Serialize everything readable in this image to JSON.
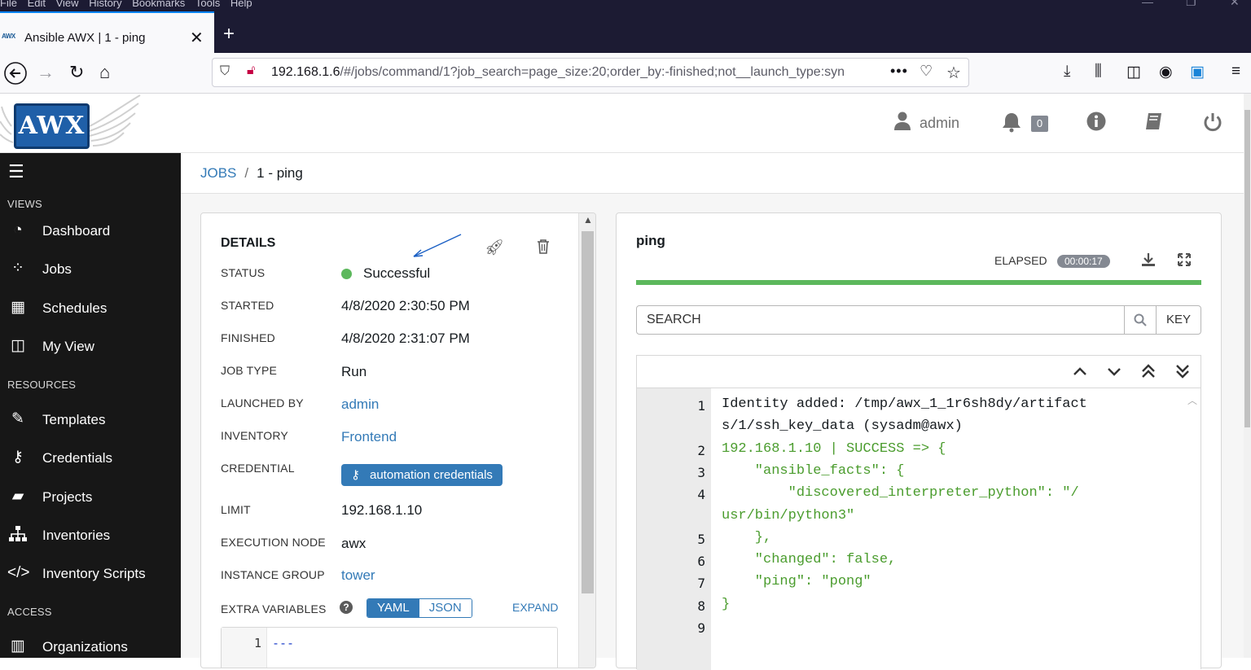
{
  "browser": {
    "menu": [
      "File",
      "Edit",
      "View",
      "History",
      "Bookmarks",
      "Tools",
      "Help"
    ],
    "tab_title": "Ansible AWX | 1 - ping",
    "tab_favicon_text": "AWX",
    "url_host": "192.168.1.6",
    "url_path": "/#/jobs/command/1?job_search=page_size:20;order_by:-finished;not__launch_type:syn",
    "icons": [
      "back-icon",
      "forward-icon",
      "reload-icon",
      "home-icon",
      "shield-icon",
      "insecure-lock-icon",
      "page-actions-icon",
      "pocket-icon",
      "bookmark-star-icon",
      "download-icon",
      "library-icon",
      "sidebar-icon",
      "account-icon",
      "extension-icon",
      "menu-icon"
    ]
  },
  "header": {
    "logo_text": "AWX",
    "user": "admin",
    "notifications_count": "0"
  },
  "sidebar": {
    "sections": {
      "views": "VIEWS",
      "resources": "RESOURCES",
      "access": "ACCESS"
    },
    "items": [
      {
        "label": "Dashboard",
        "icon": "tachometer-icon"
      },
      {
        "label": "Jobs",
        "icon": "spinner-icon"
      },
      {
        "label": "Schedules",
        "icon": "calendar-icon"
      },
      {
        "label": "My View",
        "icon": "columns-icon"
      },
      {
        "label": "Templates",
        "icon": "edit-icon"
      },
      {
        "label": "Credentials",
        "icon": "key-icon"
      },
      {
        "label": "Projects",
        "icon": "folder-icon"
      },
      {
        "label": "Inventories",
        "icon": "sitemap-icon"
      },
      {
        "label": "Inventory Scripts",
        "icon": "code-icon"
      },
      {
        "label": "Organizations",
        "icon": "building-icon"
      }
    ]
  },
  "breadcrumb": {
    "parent": "JOBS",
    "separator": "/",
    "current": "1 - ping"
  },
  "details": {
    "title": "DETAILS",
    "rows": {
      "status": {
        "label": "STATUS",
        "value": "Successful"
      },
      "started": {
        "label": "STARTED",
        "value": "4/8/2020 2:30:50 PM"
      },
      "finished": {
        "label": "FINISHED",
        "value": "4/8/2020 2:31:07 PM"
      },
      "job_type": {
        "label": "JOB TYPE",
        "value": "Run"
      },
      "launched_by": {
        "label": "LAUNCHED BY",
        "value": "admin"
      },
      "inventory": {
        "label": "INVENTORY",
        "value": "Frontend"
      },
      "credential": {
        "label": "CREDENTIAL",
        "value": "automation credentials"
      },
      "limit": {
        "label": "LIMIT",
        "value": "192.168.1.10"
      },
      "execution_node": {
        "label": "EXECUTION NODE",
        "value": "awx"
      },
      "instance_group": {
        "label": "INSTANCE GROUP",
        "value": "tower"
      }
    },
    "extra_variables": {
      "label": "EXTRA VARIABLES",
      "help": "?",
      "yaml": "YAML",
      "json": "JSON",
      "expand": "EXPAND",
      "line_number": "1",
      "code": "---"
    },
    "status_color": "#5cb85c"
  },
  "output": {
    "title": "ping",
    "elapsed_label": "ELAPSED",
    "elapsed_value": "00:00:17",
    "progress": 1.0,
    "search_placeholder": "SEARCH",
    "key_label": "KEY",
    "lines": [
      {
        "n": "1",
        "text": "Identity added: /tmp/awx_1_1r6sh8dy/artifact"
      },
      {
        "n": "",
        "text": "s/1/ssh_key_data (sysadm@awx)"
      },
      {
        "n": "2",
        "text": "192.168.1.10 | SUCCESS => {"
      },
      {
        "n": "3",
        "text": "    \"ansible_facts\": {"
      },
      {
        "n": "4",
        "text": "        \"discovered_interpreter_python\": \"/"
      },
      {
        "n": "",
        "text": "usr/bin/python3\""
      },
      {
        "n": "5",
        "text": "    },"
      },
      {
        "n": "6",
        "text": "    \"changed\": false,"
      },
      {
        "n": "7",
        "text": "    \"ping\": \"pong\""
      },
      {
        "n": "8",
        "text": "}"
      },
      {
        "n": "9",
        "text": ""
      }
    ],
    "success_color": "#4a9c2d"
  }
}
